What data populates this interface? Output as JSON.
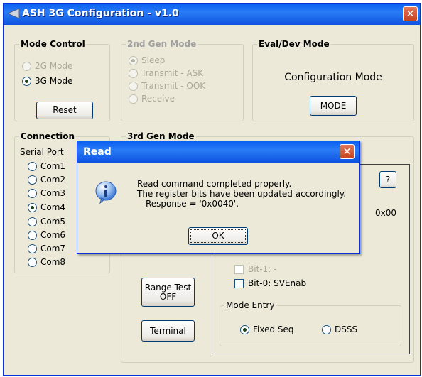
{
  "window": {
    "title": "ASH 3G Configuration - v1.0",
    "close_glyph": "✕"
  },
  "mode_control": {
    "legend": "Mode Control",
    "options": [
      {
        "label": "2G Mode",
        "selected": false,
        "disabled": true
      },
      {
        "label": "3G Mode",
        "selected": true,
        "disabled": false
      }
    ],
    "reset_label": "Reset"
  },
  "gen2_mode": {
    "legend": "2nd Gen Mode",
    "options": [
      {
        "label": "Sleep",
        "selected": true
      },
      {
        "label": "Transmit - ASK",
        "selected": false
      },
      {
        "label": "Transmit - OOK",
        "selected": false
      },
      {
        "label": "Receive",
        "selected": false
      }
    ]
  },
  "eval_mode": {
    "legend": "Eval/Dev Mode",
    "status": "Configuration Mode",
    "button_label": "MODE"
  },
  "connection": {
    "legend": "Connection",
    "serial_port_label": "Serial Port",
    "ports": [
      {
        "label": "Com1",
        "selected": false
      },
      {
        "label": "Com2",
        "selected": false
      },
      {
        "label": "Com3",
        "selected": false
      },
      {
        "label": "Com4",
        "selected": true
      },
      {
        "label": "Com5",
        "selected": false
      },
      {
        "label": "Com6",
        "selected": false
      },
      {
        "label": "Com7",
        "selected": false
      },
      {
        "label": "Com8",
        "selected": false
      }
    ]
  },
  "gen3_mode": {
    "legend": "3rd Gen Mode",
    "help_label": "?",
    "register_value": "0x00",
    "bit1_label": "Bit-1:  -",
    "bit0_label": "Bit-0:  SVEnab",
    "range_test_label_line1": "Range Test",
    "range_test_label_line2": "OFF",
    "terminal_label": "Terminal",
    "mode_entry": {
      "legend": "Mode Entry",
      "options": [
        {
          "label": "Fixed Seq",
          "selected": true
        },
        {
          "label": "DSSS",
          "selected": false
        }
      ]
    }
  },
  "dialog": {
    "title": "Read",
    "close_glyph": "✕",
    "icon": "info-icon",
    "line1": "Read command completed properly.",
    "line2": "The register bits have been updated accordingly.",
    "line3": "Response = '0x0040'.",
    "ok_label": "OK"
  }
}
